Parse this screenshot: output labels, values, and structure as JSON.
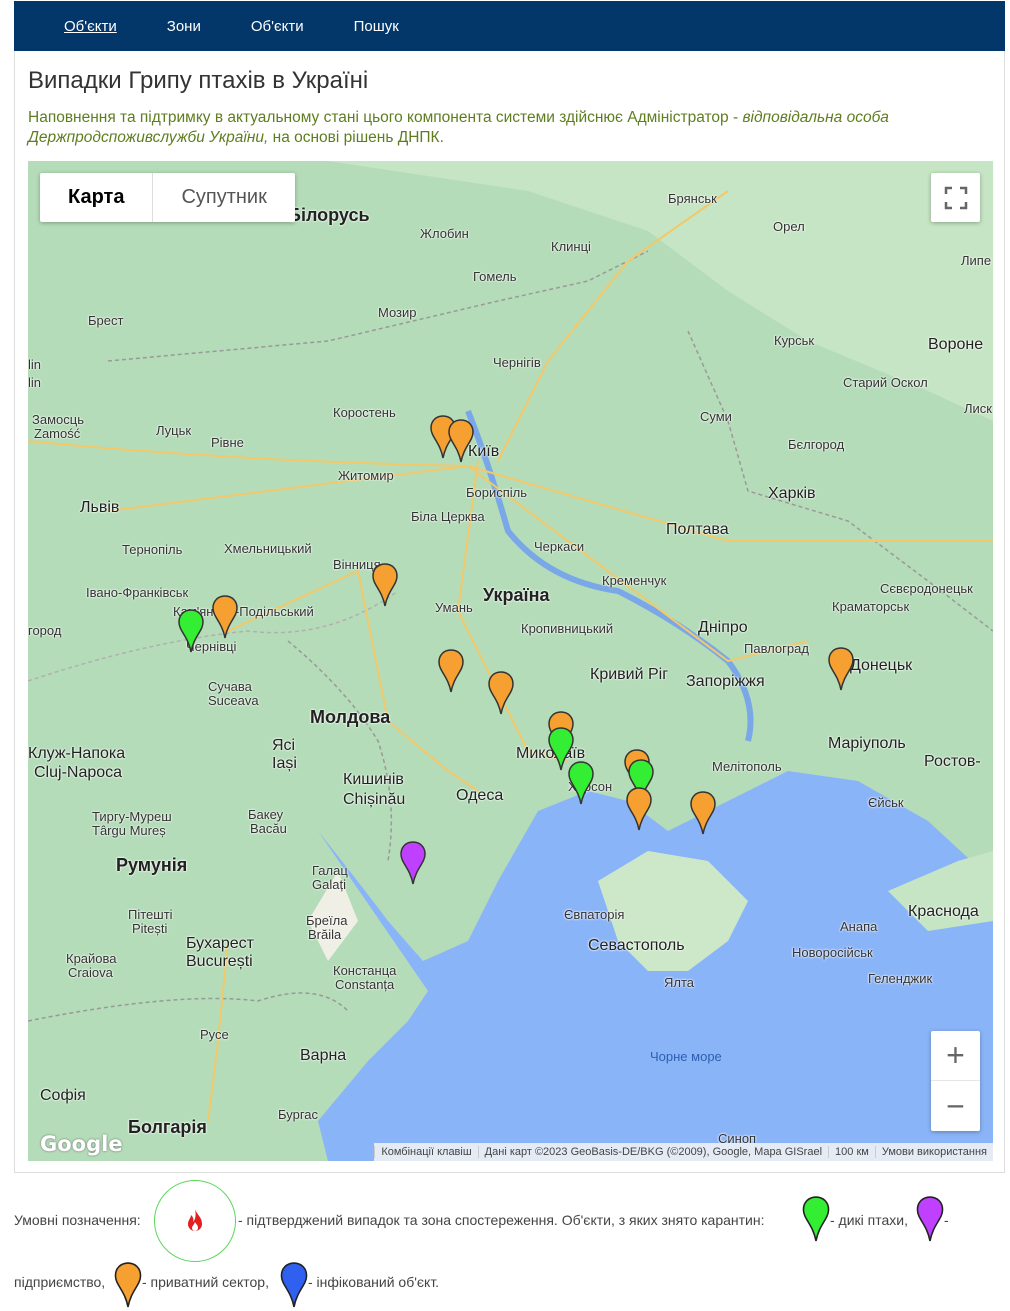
{
  "nav": [
    {
      "label": "Об'єкти",
      "active": true
    },
    {
      "label": "Зони",
      "active": false
    },
    {
      "label": "Об'єкти",
      "active": false
    },
    {
      "label": "Пошук",
      "active": false
    }
  ],
  "page": {
    "title": "Випадки Грипу птахів в Україні",
    "desc_part1": "Наповнення та підтримку в актуальному стані цього компонента системи здійснює Адміністратор - ",
    "desc_italic": "відповідальна особа Держпродспоживслужби України,",
    "desc_part2": " на основі рішень ДНПК."
  },
  "map": {
    "type_map": "Карта",
    "type_satellite": "Супутник",
    "zoom_in": "+",
    "zoom_out": "−",
    "google": "Google",
    "attr_shortcuts": "Комбінації клавіш",
    "attr_data": "Дані карт ©2023 GeoBasis-DE/BKG (©2009), Google, Mapa GISrael",
    "attr_scale": "100 км",
    "attr_terms": "Умови використання",
    "labels": {
      "belarus": "Білорусь",
      "ukraine": "Україна",
      "moldova": "Молдова",
      "romania": "Румунія",
      "bulgaria": "Болгарія",
      "kyiv": "Київ",
      "kharkiv": "Харків",
      "dnipro": "Дніпро",
      "donetsk": "Донецьк",
      "lviv": "Львів",
      "odesa": "Одеса",
      "mykolaiv": "Миколаїв",
      "kherson": "Херсон",
      "zaporizhzhia": "Запоріжжя",
      "kryvyi_rih": "Кривий Ріг",
      "poltava": "Полтава",
      "mariupol": "Маріуполь",
      "sevastopol": "Севастополь",
      "krasnodar": "Краснода",
      "chisinau": "Кишинів",
      "chisinau_ro": "Chișinău",
      "bucharest": "Бухарест",
      "bucharest_ro": "București",
      "sofia": "Софія",
      "varna": "Варна",
      "yasi": "Ясі",
      "iasi": "Iași",
      "kluzh": "Клуж-Напока",
      "cluj": "Cluj-Napoca",
      "brest": "Брест",
      "homel": "Гомель",
      "mozyr": "Мозир",
      "zhlobin": "Жлобин",
      "klintsy": "Клинці",
      "bryansk": "Брянськ",
      "orel": "Орел",
      "kursk": "Курськ",
      "voronezh": "Вороне",
      "lipetsk": "Липе",
      "staryi_oskol": "Старий Оскол",
      "belgorod": "Бєлгород",
      "sumy": "Суми",
      "chernihiv": "Чернігів",
      "korosten": "Коростень",
      "zhytomyr": "Житомир",
      "boryspil": "Бориспіль",
      "bila_tserkva": "Біла Церква",
      "cherkasy": "Черкаси",
      "kremenchuk": "Кременчук",
      "uman": "Умань",
      "kropyvnytskyi": "Кропивницький",
      "vinnytsia": "Вінниця",
      "khmelnytskyi": "Хмельницький",
      "ternopil": "Тернопіль",
      "ivano": "Івано-Франківськ",
      "kamianets": "Кам'янець-Подільський",
      "chernivtsi": "Чернівці",
      "suchava": "Сучава",
      "suceava": "Suceava",
      "lutsk": "Луцьк",
      "rivne": "Рівне",
      "zamosc_ua": "Замосць",
      "zamosc": "Zamość",
      "pavlohrad": "Павлоград",
      "kramatorsk": "Краматорськ",
      "sievierodonetsk": "Сєвєродонецьк",
      "melitopol": "Мелітополь",
      "yeisk": "Єйськ",
      "rostov": "Ростов-",
      "berdiansk": "",
      "yevpatoriia": "Євпаторія",
      "yalta": "Ялта",
      "anapa": "Анапа",
      "novorossiysk": "Новоросійськ",
      "gelendzhik": "Геленджик",
      "black_sea": "Чорне море",
      "constanta_ua": "Констанца",
      "constanta": "Constanța",
      "galati_ua": "Галац",
      "galati": "Galați",
      "braila_ua": "Бреїла",
      "braila": "Brăila",
      "bacau_ua": "Бакеу",
      "bacau": "Bacău",
      "targu_ua": "Тиргу-Муреш",
      "targu": "Târgu Mureș",
      "pitesti_ua": "Пітешті",
      "pitesti": "Pitești",
      "craiova_ua": "Крайова",
      "craiova": "Craiova",
      "ruse": "Русе",
      "burgas": "Бургас",
      "sinop": "Синоп",
      "lin": "lin",
      "lin2": "lin",
      "lysk": "Лиск",
      "horod": "город"
    },
    "pins": [
      {
        "color": "orange"
      },
      {
        "color": "orange"
      },
      {
        "color": "orange"
      },
      {
        "color": "orange"
      },
      {
        "color": "green"
      },
      {
        "color": "orange"
      },
      {
        "color": "orange"
      },
      {
        "color": "orange"
      },
      {
        "color": "orange"
      },
      {
        "color": "green"
      },
      {
        "color": "green"
      },
      {
        "color": "orange"
      },
      {
        "color": "green"
      },
      {
        "color": "orange"
      },
      {
        "color": "orange"
      },
      {
        "color": "purple"
      }
    ]
  },
  "legend": {
    "prefix": "Умовні позначення:",
    "confirmed": "- підтверджений випадок та зона спостереження. Об'єкти, з яких знято карантин:",
    "wild": "- дикі птахи,",
    "dash": "-",
    "enterprise": "підприємство,",
    "private": "- приватний сектор,",
    "infected": "- інфікований об'єкт.",
    "colors": {
      "green": "#33ee33",
      "purple": "#c040ff",
      "orange": "#f5a030",
      "blue": "#3060f0",
      "fire": "#e02020"
    }
  }
}
